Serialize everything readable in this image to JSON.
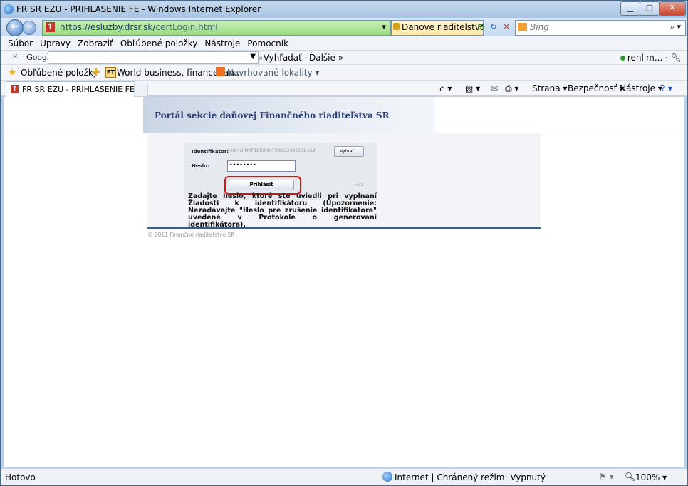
{
  "window": {
    "title": "FR SR EZU - PRIHLASENIE FE - Windows Internet Explorer"
  },
  "address": {
    "url_host": "https://esluzby.drsr.sk/",
    "url_path": "certLogin.html",
    "cert_label": "Danove riaditelstvo...",
    "search_placeholder": "Bing"
  },
  "menu": [
    "Súbor",
    "Úpravy",
    "Zobraziť",
    "Obľúbené položky",
    "Nástroje",
    "Pomocník"
  ],
  "google_toolbar": {
    "close": "×",
    "logo": "Google",
    "search_label": "Vyhľadať ·",
    "more_label": "Ďalšie »",
    "user": "renlim... ·"
  },
  "favorites": {
    "label": "Obľúbené položky",
    "ft_icon_text": "FT",
    "item1": "World business, finance, an...",
    "item2": "Navrhované lokality"
  },
  "tab": {
    "label": "FR SR EZU - PRIHLASENIE FE"
  },
  "commands": {
    "page": "Strana",
    "safety": "Bezpečnosť",
    "tools": "Nástroje"
  },
  "page": {
    "banner_title": "Portál sekcie daňovej Finančného riaditeľstva SR",
    "id_label": "Identifikátor:",
    "id_value": "rs\\Emil.MRP1BR\\PKI-FS\\8022483601.p12",
    "browse_label": "Vybrať...",
    "pwd_label": "Heslo:",
    "pwd_value": "••••••••",
    "login_label": "Prihlásiť",
    "version": "v1.2",
    "instructions": "Zadajte heslo, ktoré ste uviedli pri vyplnaní Žiadosti k identifikátoru (Upozornenie: Nezadávajte \"Heslo pre zrušenie identifikátora\" uvedené v Protokole o generovaní identifikátora).",
    "copyright": "© 2011 Finančné riaditeľstvo SR"
  },
  "status": {
    "text": "Hotovo",
    "zone": "Internet | Chránený režim: Vypnutý",
    "zoom": "100%"
  },
  "colors": {
    "banner_text": "#2b3f78",
    "panel_border": "#2a5e9e",
    "highlight": "#dd1111"
  }
}
